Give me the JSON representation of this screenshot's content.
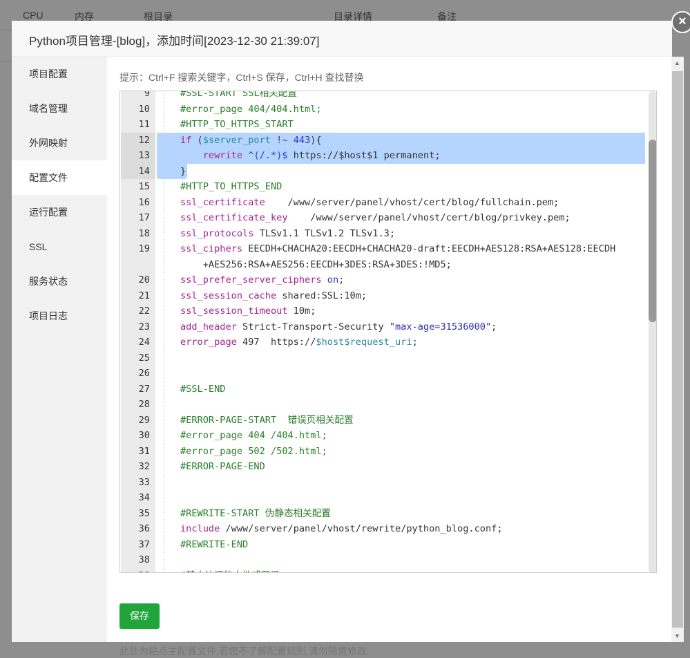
{
  "background_table": {
    "headers": [
      "CPU",
      "内存",
      "根目录",
      "目录详情",
      "备注"
    ]
  },
  "modal": {
    "title": "Python项目管理-[blog]，添加时间[2023-12-30 21:39:07]",
    "close_icon": "close-icon"
  },
  "sidebar": {
    "items": [
      {
        "label": "项目配置"
      },
      {
        "label": "域名管理"
      },
      {
        "label": "外网映射"
      },
      {
        "label": "配置文件",
        "active": true
      },
      {
        "label": "运行配置"
      },
      {
        "label": "SSL"
      },
      {
        "label": "服务状态"
      },
      {
        "label": "项目日志"
      }
    ]
  },
  "content": {
    "tip": "提示：Ctrl+F 搜索关键字，Ctrl+S 保存，Ctrl+H 查找替换",
    "save_label": "保存",
    "note": "此处为站点主配置文件,若您不了解配置规则,请勿随意修改."
  },
  "colors": {
    "accent": "#20a53a",
    "selection": "#b5d5ff"
  },
  "editor": {
    "lines": [
      {
        "num": "9",
        "tokens": [
          [
            "c",
            "#SSL-START SSL相关配置"
          ]
        ]
      },
      {
        "num": "10",
        "tokens": [
          [
            "c",
            "#error_page 404/404.html;"
          ]
        ]
      },
      {
        "num": "11",
        "tokens": [
          [
            "c",
            "#HTTP_TO_HTTPS_START"
          ]
        ]
      },
      {
        "num": "12",
        "sel": true,
        "tokens": [
          [
            "k",
            "if"
          ],
          [
            "p",
            " ("
          ],
          [
            "v",
            "$server_port"
          ],
          [
            "p",
            " "
          ],
          [
            "n",
            "!~"
          ],
          [
            "p",
            " "
          ],
          [
            "n",
            "443"
          ],
          [
            "p",
            "){"
          ]
        ]
      },
      {
        "num": "13",
        "sel": true,
        "indent": true,
        "tokens": [
          [
            "p",
            "    "
          ],
          [
            "k",
            "rewrite"
          ],
          [
            "p",
            " "
          ],
          [
            "n",
            "^(/.*)$"
          ],
          [
            "p",
            " https://$host$1 permanent;"
          ]
        ]
      },
      {
        "num": "14",
        "sel": true,
        "last": true,
        "tokens": [
          [
            "p",
            "}"
          ]
        ]
      },
      {
        "num": "15",
        "tokens": [
          [
            "c",
            "#HTTP_TO_HTTPS_END"
          ]
        ]
      },
      {
        "num": "16",
        "tokens": [
          [
            "k",
            "ssl_certificate"
          ],
          [
            "p",
            "    /www/server/panel/vhost/cert/blog/fullchain.pem;"
          ]
        ]
      },
      {
        "num": "17",
        "tokens": [
          [
            "k",
            "ssl_certificate_key"
          ],
          [
            "p",
            "    /www/server/panel/vhost/cert/blog/privkey.pem;"
          ]
        ]
      },
      {
        "num": "18",
        "tokens": [
          [
            "k",
            "ssl_protocols"
          ],
          [
            "p",
            " TLSv1.1 TLSv1.2 TLSv1.3;"
          ]
        ]
      },
      {
        "num": "19",
        "tokens": [
          [
            "k",
            "ssl_ciphers"
          ],
          [
            "p",
            " EECDH+CHACHA20:EECDH+CHACHA20-draft:EECDH+AES128:RSA+AES128:EECDH"
          ]
        ]
      },
      {
        "num": "",
        "tokens": [
          [
            "p",
            "    +AES256:RSA+AES256:EECDH+3DES:RSA+3DES:!MD5;"
          ]
        ]
      },
      {
        "num": "20",
        "tokens": [
          [
            "k",
            "ssl_prefer_server_ciphers"
          ],
          [
            "p",
            " "
          ],
          [
            "n",
            "on"
          ],
          [
            "p",
            ";"
          ]
        ]
      },
      {
        "num": "21",
        "tokens": [
          [
            "k",
            "ssl_session_cache"
          ],
          [
            "p",
            " shared:SSL:10m;"
          ]
        ]
      },
      {
        "num": "22",
        "tokens": [
          [
            "k",
            "ssl_session_timeout"
          ],
          [
            "p",
            " 10m;"
          ]
        ]
      },
      {
        "num": "23",
        "tokens": [
          [
            "k",
            "add_header"
          ],
          [
            "p",
            " Strict-Transport-Security "
          ],
          [
            "s",
            "\"max-age=31536000\""
          ],
          [
            "p",
            ";"
          ]
        ]
      },
      {
        "num": "24",
        "tokens": [
          [
            "k",
            "error_page"
          ],
          [
            "p",
            " 497  https://"
          ],
          [
            "v",
            "$host$request_uri"
          ],
          [
            "p",
            ";"
          ]
        ]
      },
      {
        "num": "25",
        "tokens": []
      },
      {
        "num": "26",
        "tokens": []
      },
      {
        "num": "27",
        "tokens": [
          [
            "c",
            "#SSL-END"
          ]
        ]
      },
      {
        "num": "28",
        "tokens": []
      },
      {
        "num": "29",
        "tokens": [
          [
            "c",
            "#ERROR-PAGE-START  错误页相关配置"
          ]
        ]
      },
      {
        "num": "30",
        "tokens": [
          [
            "c",
            "#error_page 404 /404.html;"
          ]
        ]
      },
      {
        "num": "31",
        "tokens": [
          [
            "c",
            "#error_page 502 /502.html;"
          ]
        ]
      },
      {
        "num": "32",
        "tokens": [
          [
            "c",
            "#ERROR-PAGE-END"
          ]
        ]
      },
      {
        "num": "33",
        "tokens": []
      },
      {
        "num": "34",
        "tokens": []
      },
      {
        "num": "35",
        "tokens": [
          [
            "c",
            "#REWRITE-START 伪静态相关配置"
          ]
        ]
      },
      {
        "num": "36",
        "tokens": [
          [
            "k",
            "include"
          ],
          [
            "p",
            " /www/server/panel/vhost/rewrite/python_blog.conf;"
          ]
        ]
      },
      {
        "num": "37",
        "tokens": [
          [
            "c",
            "#REWRITE-END"
          ]
        ]
      },
      {
        "num": "38",
        "tokens": []
      },
      {
        "num": "39",
        "tokens": [
          [
            "c",
            "#禁止访问的文件或目录"
          ]
        ]
      }
    ]
  }
}
